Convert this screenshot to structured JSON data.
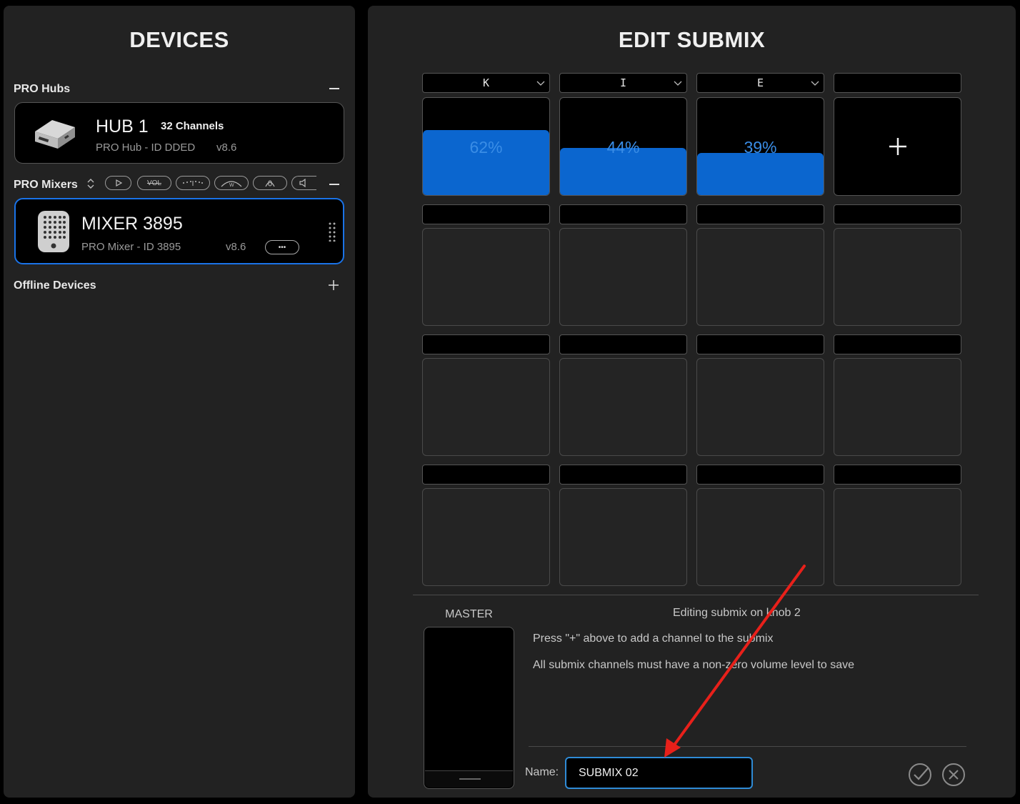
{
  "devices": {
    "title": "DEVICES",
    "hubs_section": "PRO Hubs",
    "hub": {
      "name": "HUB 1",
      "channels": "32 Channels",
      "subtitle": "PRO Hub - ID DDED",
      "version": "v8.6",
      "icon": "hub-device-icon"
    },
    "mixers_section": "PRO Mixers",
    "mixer_chips": [
      "play-chip",
      "vol-chip",
      "eq-chip",
      "w-chip",
      "mic-chip",
      "speaker-chip"
    ],
    "mixer_chip_labels": {
      "vol": "VOL",
      "w": "W"
    },
    "mixer": {
      "name": "MIXER 3895",
      "subtitle": "PRO Mixer - ID 3895",
      "version": "v8.6",
      "more": "•••",
      "icon": "mixer-device-icon"
    },
    "offline_section": "Offline Devices"
  },
  "submix": {
    "title": "EDIT SUBMIX",
    "slots_row1": [
      {
        "label": "K",
        "percent": "62%",
        "level": 0.62
      },
      {
        "label": "I",
        "percent": "44%",
        "level": 0.44
      },
      {
        "label": "E",
        "percent": "39%",
        "level": 0.39
      }
    ],
    "add_label": "+",
    "master_label": "MASTER",
    "editing_text": "Editing submix on knob 2",
    "hint1": "Press \"+\" above to add a channel to the submix",
    "hint2": "All submix channels must have a non-zero volume level to save",
    "name_label": "Name:",
    "name_value": "SUBMIX 02"
  },
  "colors": {
    "accent": "#1a73e8",
    "fill": "#0b66cf",
    "annotation_arrow": "#e8201a"
  }
}
